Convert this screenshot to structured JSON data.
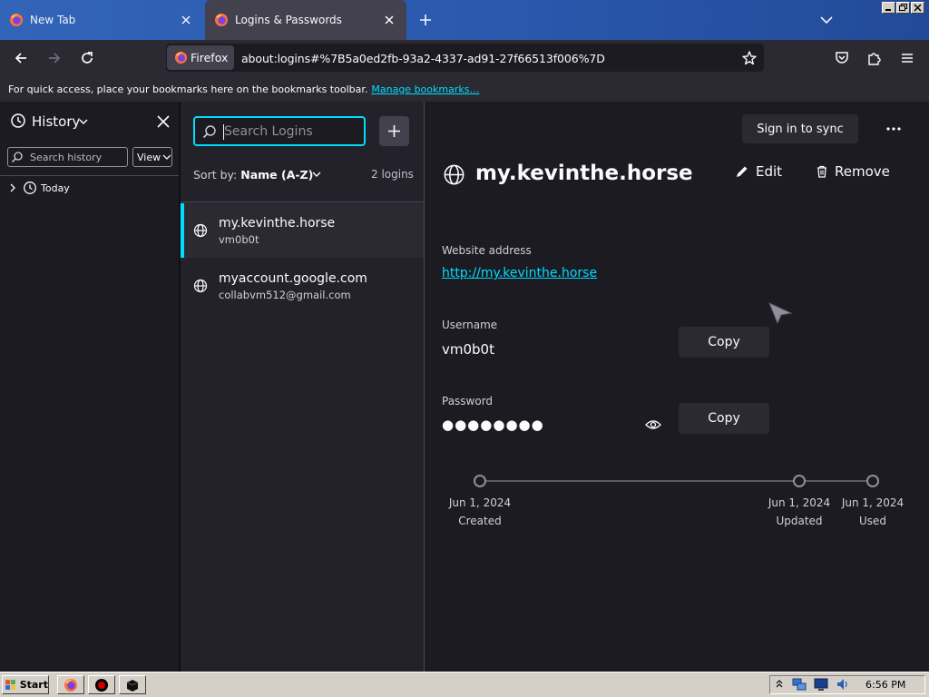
{
  "browser": {
    "tabs": [
      {
        "title": "New Tab",
        "active": false,
        "icon": "firefox-icon"
      },
      {
        "title": "Logins & Passwords",
        "active": true,
        "icon": "firefox-icon"
      }
    ],
    "identity_label": "Firefox",
    "url": "about:logins#%7B5a0ed2fb-93a2-4337-ad91-27f66513f006%7D",
    "bookmarks_message": "For quick access, place your bookmarks here on the bookmarks toolbar.",
    "bookmarks_link": "Manage bookmarks…"
  },
  "sidebar": {
    "title": "History",
    "search_placeholder": "Search history",
    "view_label": "View",
    "groups": [
      {
        "label": "Today"
      }
    ]
  },
  "logins": {
    "search_placeholder": "Search Logins",
    "sort_prefix": "Sort by:",
    "sort_value": "Name (A-Z)",
    "count": "2 logins",
    "items": [
      {
        "title": "my.kevinthe.horse",
        "user": "vm0b0t",
        "selected": true
      },
      {
        "title": "myaccount.google.com",
        "user": "collabvm512@gmail.com",
        "selected": false
      }
    ]
  },
  "detail": {
    "sync_label": "Sign in to sync",
    "title": "my.kevinthe.horse",
    "edit_label": "Edit",
    "remove_label": "Remove",
    "website_label": "Website address",
    "website_value": "http://my.kevinthe.horse",
    "username_label": "Username",
    "username_value": "vm0b0t",
    "password_label": "Password",
    "password_value": "●●●●●●●●",
    "copy_label": "Copy",
    "timeline": [
      {
        "date": "Jun 1, 2024",
        "label": "Created"
      },
      {
        "date": "Jun 1, 2024",
        "label": "Updated"
      },
      {
        "date": "Jun 1, 2024",
        "label": "Used"
      }
    ]
  },
  "taskbar": {
    "start_label": "Start",
    "time": "6:56 PM"
  },
  "colors": {
    "accent": "#00ddff",
    "tabstrip": "#2a58ad",
    "panel": "#1c1b22",
    "toolbar": "#2b2a33"
  }
}
